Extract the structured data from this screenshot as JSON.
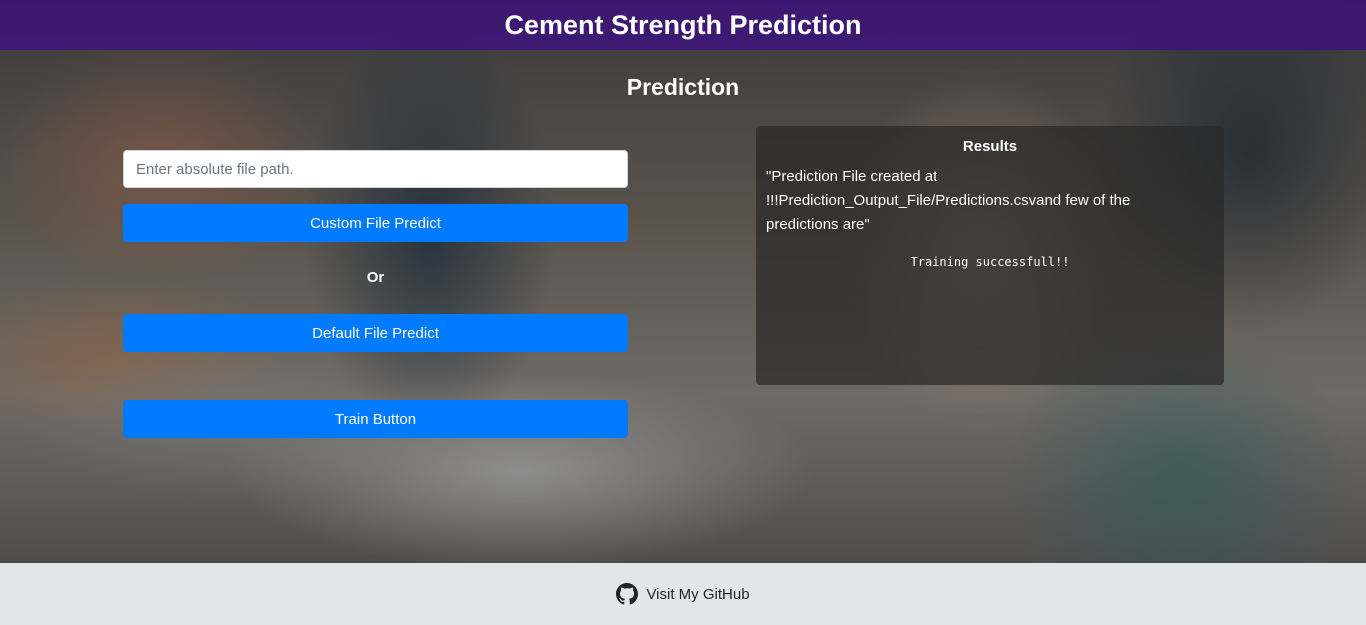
{
  "header": {
    "title": "Cement Strength Prediction"
  },
  "section": {
    "title": "Prediction"
  },
  "form": {
    "path_placeholder": "Enter absolute file path.",
    "custom_button": "Custom File Predict",
    "or_label": "Or",
    "default_button": "Default File Predict",
    "train_button": "Train Button"
  },
  "results": {
    "title": "Results",
    "message": "\"Prediction File created at !!!Prediction_Output_File/Predictions.csvand few of the predictions are\"",
    "output": "Training successfull!!"
  },
  "footer": {
    "link_label": "Visit My GitHub",
    "icon": "github-icon"
  },
  "colors": {
    "header_bg": "#3d1082",
    "button_primary": "#007bff",
    "footer_bg": "#e2e6ea"
  }
}
